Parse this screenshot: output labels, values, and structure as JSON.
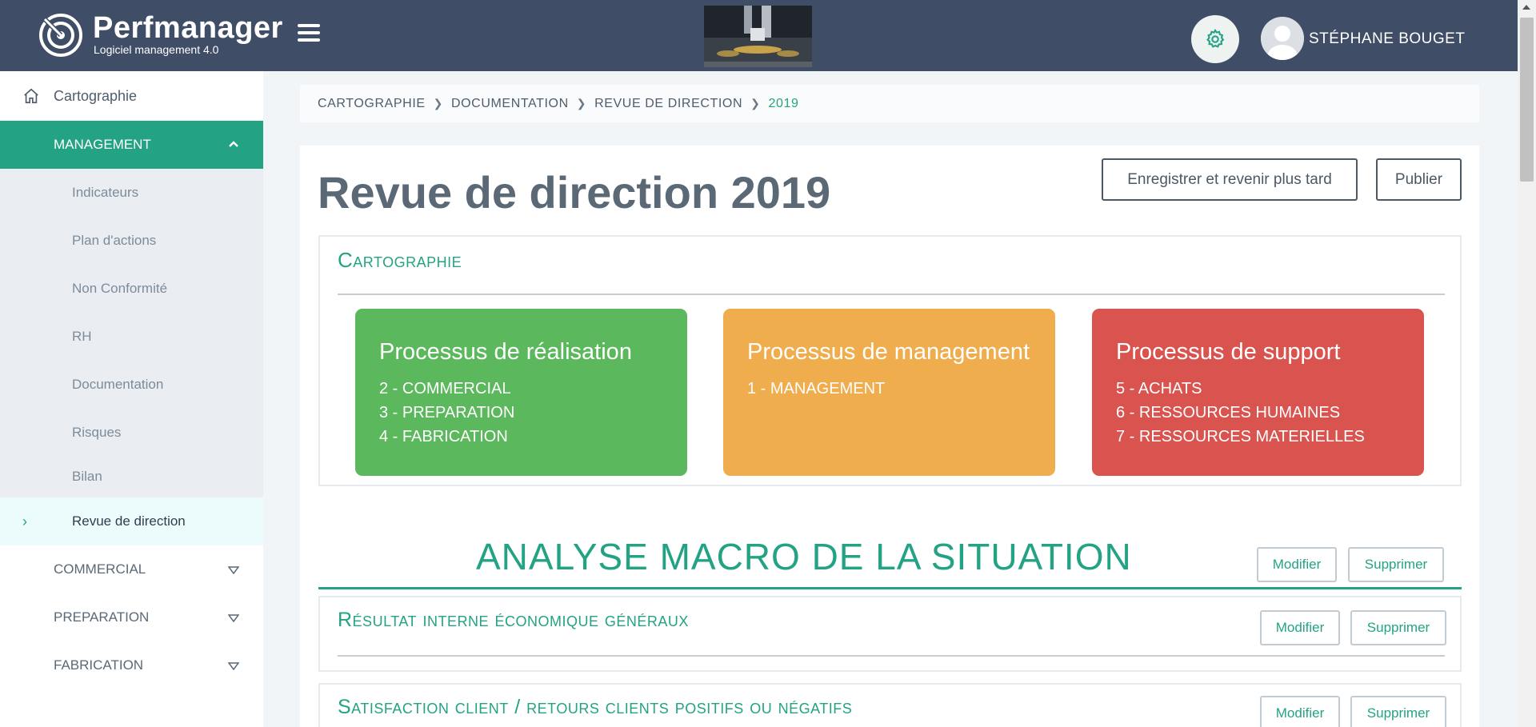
{
  "header": {
    "brand_name": "Perfmanager",
    "brand_tagline": "Logiciel management 4.0",
    "user_name": "STÉPHANE BOUGET",
    "icons": {
      "logo": "target-logo-icon",
      "menu": "hamburger-menu-icon",
      "settings": "gear-icon",
      "avatar": "user-avatar-icon"
    }
  },
  "sidebar": {
    "home_label": "Cartographie",
    "management_label": "MANAGEMENT",
    "management_items": [
      "Indicateurs",
      "Plan d'actions",
      "Non Conformité",
      "RH",
      "Documentation",
      "Risques",
      "Bilan",
      "Revue de direction"
    ],
    "active_item": "Revue de direction",
    "groups": [
      "COMMERCIAL",
      "PREPARATION",
      "FABRICATION"
    ]
  },
  "breadcrumb": [
    "CARTOGRAPHIE",
    "DOCUMENTATION",
    "REVUE DE DIRECTION",
    "2019"
  ],
  "page": {
    "title": "Revue de direction 2019",
    "save_button": "Enregistrer et revenir plus tard",
    "publish_button": "Publier"
  },
  "cartographie": {
    "title": "Cartographie",
    "processes": [
      {
        "name": "Processus de réalisation",
        "color": "#5cb85c",
        "items": [
          "2 - COMMERCIAL",
          "3 - PREPARATION",
          "4 - FABRICATION"
        ]
      },
      {
        "name": "Processus de management",
        "color": "#f0ad4e",
        "items": [
          "1 - MANAGEMENT"
        ]
      },
      {
        "name": "Processus de support",
        "color": "#d9534f",
        "items": [
          "5 - ACHATS",
          "6 - RESSOURCES HUMAINES",
          "7 - RESSOURCES MATERIELLES"
        ]
      }
    ]
  },
  "analyse": {
    "title": "ANALYSE MACRO DE LA SITUATION",
    "modify_label": "Modifier",
    "delete_label": "Supprimer",
    "sections": [
      {
        "title": "Résultat interne économique généraux"
      },
      {
        "title": "Satisfaction client / retours clients positifs ou négatifs"
      }
    ]
  },
  "colors": {
    "topbar": "#3f4d66",
    "accent": "#23a384",
    "sidebar_sub_bg": "#eaeef3"
  }
}
